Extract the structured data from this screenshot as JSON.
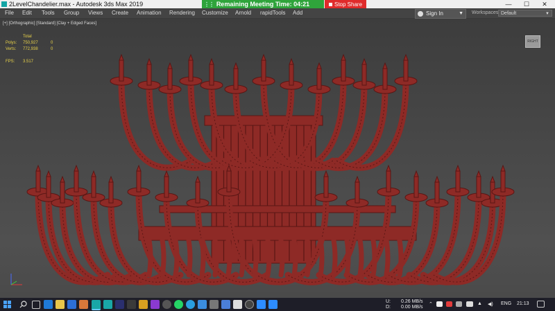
{
  "window": {
    "title": "2LevelChandelier.max - Autodesk 3ds Max 2019",
    "minimize": "—",
    "maximize": "☐",
    "close": "✕"
  },
  "meeting": {
    "remaining": "Remaining Meeting Time: 04:21",
    "stop_share": "Stop Share",
    "accent": "#2fa43b",
    "stop_color": "#e02b2b"
  },
  "menu": {
    "items": [
      "File",
      "Edit",
      "Tools",
      "Group",
      "Views",
      "Create",
      "Animation",
      "Rendering",
      "Customize",
      "Arnold",
      "rapidTools",
      "Add"
    ],
    "sign_in": "Sign In",
    "workspaces_label": "Workspaces:",
    "workspace_value": "Default"
  },
  "viewport": {
    "label": "[+] [Orthographic] [Standard] [Clay + Edged Faces]",
    "stats": {
      "header": "Total",
      "polys_label": "Polys:",
      "polys_total": "750,927",
      "polys_sel": "0",
      "verts_label": "Verts:",
      "verts_total": "772,938",
      "verts_sel": "0",
      "fps_label": "FPS:",
      "fps_value": "3.517"
    },
    "viewcube_label": "RIGHT",
    "model_color": "#8e2a26"
  },
  "taskbar": {
    "upload": "0.26 MB/s",
    "download": "0.00 MB/s",
    "up_label": "U:",
    "down_label": "D:",
    "language": "ENG",
    "time": "21:13"
  }
}
